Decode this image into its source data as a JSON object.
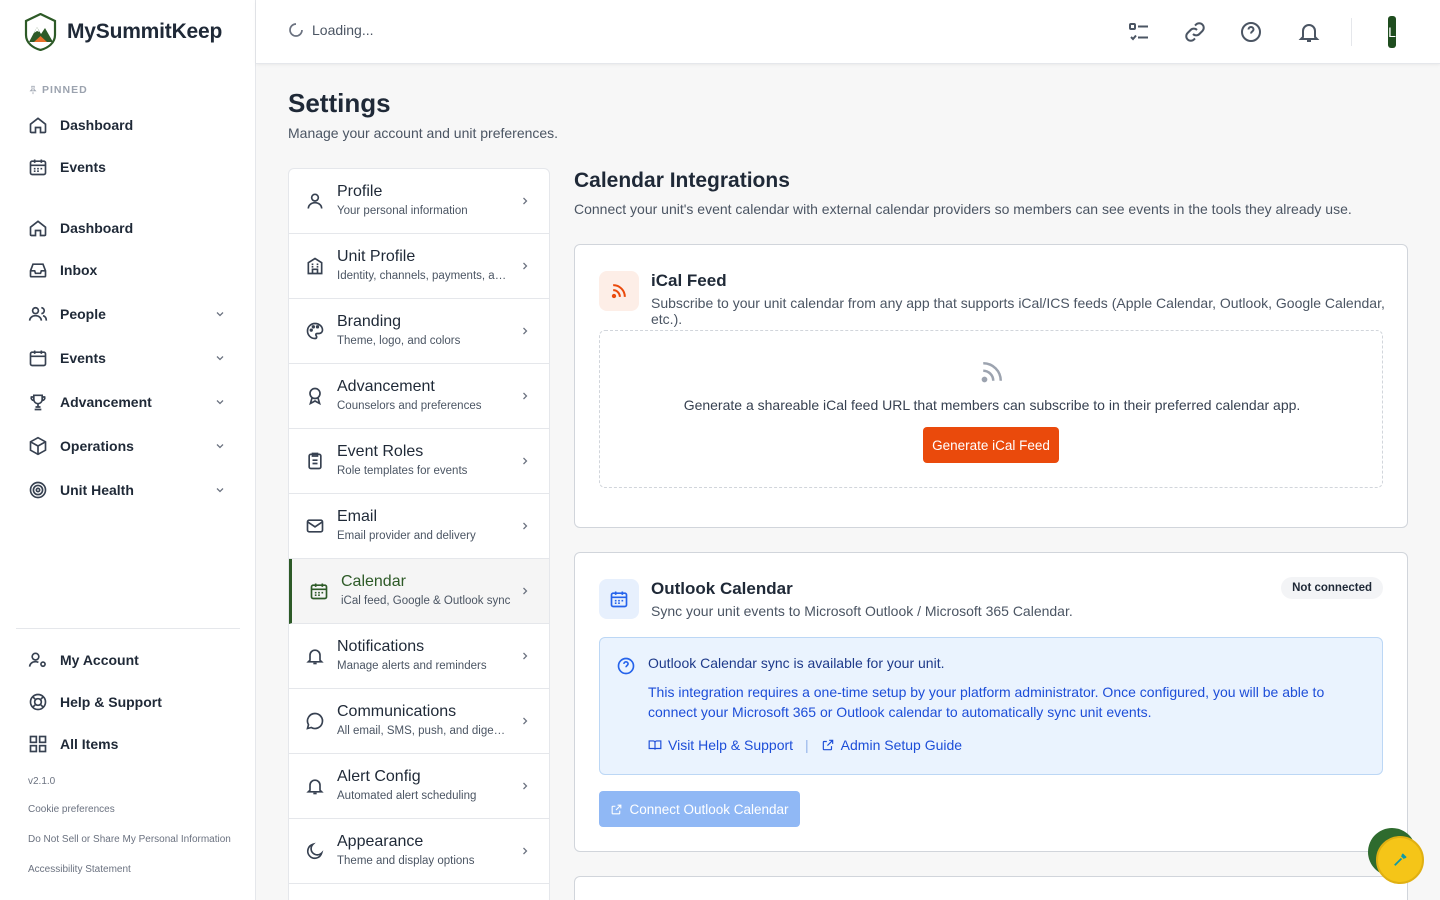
{
  "brand": {
    "name": "MySummitKeep"
  },
  "topbar": {
    "loading_text": "Loading...",
    "avatar_letter": "L"
  },
  "sidebar": {
    "pinned_label": "PINNED",
    "pinned": [
      {
        "label": "Dashboard",
        "icon": "home-icon"
      },
      {
        "label": "Events",
        "icon": "calendar-icon"
      }
    ],
    "items": [
      {
        "label": "Dashboard",
        "icon": "home-icon"
      },
      {
        "label": "Inbox",
        "icon": "inbox-icon"
      },
      {
        "label": "People",
        "icon": "people-icon"
      },
      {
        "label": "Events",
        "icon": "calendar-icon"
      },
      {
        "label": "Advancement",
        "icon": "trophy-icon"
      },
      {
        "label": "Operations",
        "icon": "box-icon"
      },
      {
        "label": "Unit Health",
        "icon": "target-icon"
      }
    ],
    "footer_items": [
      {
        "label": "My Account",
        "icon": "user-gear-icon"
      },
      {
        "label": "Help & Support",
        "icon": "lifebuoy-icon"
      },
      {
        "label": "All Items",
        "icon": "grid-icon"
      }
    ],
    "version": "v2.1.0",
    "cookie_prefs": "Cookie preferences",
    "do_not_sell": "Do Not Sell or Share My Personal Information",
    "accessibility": "Accessibility Statement"
  },
  "page": {
    "title": "Settings",
    "subtitle": "Manage your account and unit preferences."
  },
  "settings_nav": [
    {
      "title": "Profile",
      "sub": "Your personal information"
    },
    {
      "title": "Unit Profile",
      "sub": "Identity, channels, payments, and more"
    },
    {
      "title": "Branding",
      "sub": "Theme, logo, and colors"
    },
    {
      "title": "Advancement",
      "sub": "Counselors and preferences"
    },
    {
      "title": "Event Roles",
      "sub": "Role templates for events"
    },
    {
      "title": "Email",
      "sub": "Email provider and delivery"
    },
    {
      "title": "Calendar",
      "sub": "iCal feed, Google & Outlook sync"
    },
    {
      "title": "Notifications",
      "sub": "Manage alerts and reminders"
    },
    {
      "title": "Communications",
      "sub": "All email, SMS, push, and digest settings"
    },
    {
      "title": "Alert Config",
      "sub": "Automated alert scheduling"
    },
    {
      "title": "Appearance",
      "sub": "Theme and display options"
    }
  ],
  "content": {
    "title": "Calendar Integrations",
    "subtitle": "Connect your unit's event calendar with external calendar providers so members can see events in the tools they already use.",
    "ical": {
      "title": "iCal Feed",
      "subtitle": "Subscribe to your unit calendar from any app that supports iCal/ICS feeds (Apple Calendar, Outlook, Google Calendar, etc.).",
      "empty_text": "Generate a shareable iCal feed URL that members can subscribe to in their preferred calendar app.",
      "button": "Generate iCal Feed"
    },
    "outlook": {
      "title": "Outlook Calendar",
      "subtitle": "Sync your unit events to Microsoft Outlook / Microsoft 365 Calendar.",
      "badge": "Not connected",
      "info_title": "Outlook Calendar sync is available for your unit.",
      "info_body": "This integration requires a one-time setup by your platform administrator. Once configured, you will be able to connect your Microsoft 365 or Outlook calendar to automatically sync unit events.",
      "link_help": "Visit Help & Support",
      "link_guide": "Admin Setup Guide",
      "button": "Connect Outlook Calendar"
    }
  },
  "colors": {
    "brand_green": "#2d5a27",
    "orange": "#ea4a0c",
    "info_blue": "#1d4ed8"
  }
}
